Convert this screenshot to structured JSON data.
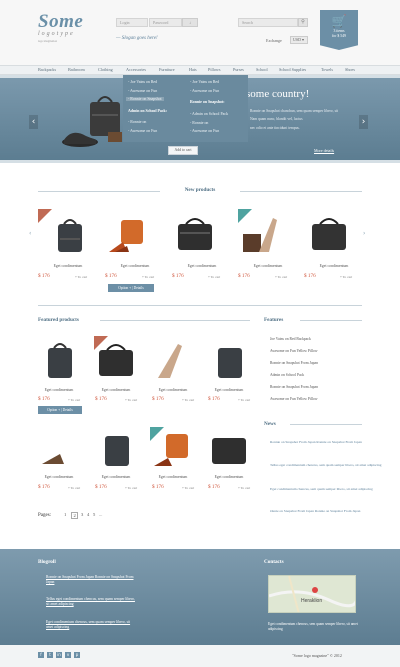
{
  "header": {
    "logo_main": "Some",
    "logo_sub": "logotype",
    "logo_tag": "logo imagination",
    "login_placeholder": "Login",
    "password_placeholder": "Password",
    "login_button": "↓",
    "slogan": "— Slogan goes here!",
    "search_placeholder": "Search",
    "search_button": "⚲",
    "exchange_label": "Exchange",
    "currency": "USD ▾",
    "cart_count": "3 items",
    "cart_total": "for $ 549"
  },
  "nav": [
    "Backpacks",
    "Bathroom",
    "Clothing",
    "Accessories",
    "Furniture",
    "Hats",
    "Pillows",
    "Purses",
    "School",
    "School Supplies",
    "Towels",
    "Shoes"
  ],
  "dropdown": {
    "col1": [
      "- Joe Vains on Red",
      "- Awesome on Fun",
      "- Ronnie on Snapshot"
    ],
    "col1_head": "Admin on School Pack:",
    "col1b": [
      "- Ronnie on",
      "- Awesome on Fun"
    ],
    "col2": [
      "- Joe Vains on Red",
      "- Awesome on Fun"
    ],
    "col2_head": "Ronnie on Snapshot:",
    "col2b": [
      "- Admin on School Pack",
      "- Ronnie on",
      "- Awesome on Fun"
    ]
  },
  "hero": {
    "title": "some country!",
    "text1": "Ronnie on Snapshot chanchun, sem quam semper libero, sit",
    "text2": "Nam quam nunc, blandit vel, luctus",
    "text3": "nec odio et ante tincidunt tempus.",
    "more": "More details",
    "add_to_cart": "Add to cart"
  },
  "new_products": {
    "title": "New products",
    "items": [
      {
        "name": "Eget condimentum",
        "price": "$ 176",
        "tocart": "+ To cart"
      },
      {
        "name": "Eget condimentum",
        "price": "$ 176",
        "tocart": "+ To cart"
      },
      {
        "name": "Eget condimentum",
        "price": "$ 176",
        "tocart": "+ To cart"
      },
      {
        "name": "Eget condimentum",
        "price": "$ 176",
        "tocart": "+ To cart"
      },
      {
        "name": "Eget condimentum",
        "price": "$ 176",
        "tocart": "+ To cart"
      }
    ],
    "option_label": "Option + | Details"
  },
  "featured": {
    "title": "Featured products",
    "items": [
      {
        "name": "Eget condimentum",
        "price": "$ 176",
        "tocart": "+ To cart"
      },
      {
        "name": "Eget condimentum",
        "price": "$ 176",
        "tocart": "+ To cart"
      },
      {
        "name": "Eget condimentum",
        "price": "$ 176",
        "tocart": "+ To cart"
      },
      {
        "name": "Eget condimentum",
        "price": "$ 176",
        "tocart": "+ To cart"
      },
      {
        "name": "Eget condimentum",
        "price": "$ 176",
        "tocart": "+ To cart"
      },
      {
        "name": "Eget condimentum",
        "price": "$ 176",
        "tocart": "+ To cart"
      },
      {
        "name": "Eget condimentum",
        "price": "$ 176",
        "tocart": "+ To cart"
      },
      {
        "name": "Eget condimentum",
        "price": "$ 176",
        "tocart": "+ To cart"
      }
    ],
    "option_label": "Option + | Details"
  },
  "features": {
    "title": "Features",
    "items": [
      "Joe Vains on Red Backpack",
      "Awesome on Fun Yellow Pillow",
      "Ronnie on Snapshot From Japan",
      "Admin on School Pack",
      "Ronnie on Snapshot From Japan",
      "Awesome on Fun Yellow Pillow"
    ]
  },
  "news": {
    "title": "News",
    "items": [
      "Ronnie on Snapshot From Japan Ronnie on Snapshot From Japan",
      "Tellus eget condimentum chencus, sem quam semper libero, sit amet adipiscing",
      "Eget condimentum chencus, sem quam semper libero, sit amet adipiscing",
      "Ounie on Snapshot From Japan Ronnie on Snapshot From Japan"
    ]
  },
  "pager": {
    "label": "Pages:",
    "pages": [
      "1",
      "2",
      "3",
      "4",
      "5",
      "..."
    ]
  },
  "footer": {
    "blogroll_title": "Blogroll",
    "blogroll": [
      "Ronnie on Snapshot From Japan Ronnie on Snapshot From Japan",
      "Tellus eget condimentum chencus, sem quam semper libero, sit amet adipiscing",
      "Eget condimentum chencus, sem quam semper libero, sit amet adipiscing"
    ],
    "contacts_title": "Contacts",
    "map_label": "Heraklion",
    "contact_text": "Eget condimentum chencus, sem quam semper libero, sit amet adipiscing",
    "copyright": "\"Some logo magazine\"  ©  2012"
  },
  "social": [
    "f",
    "t",
    "in",
    "v",
    "p"
  ],
  "colors": {
    "accent": "#6c8fa6",
    "price": "#d0573d",
    "footer": "#6d8ba0"
  }
}
